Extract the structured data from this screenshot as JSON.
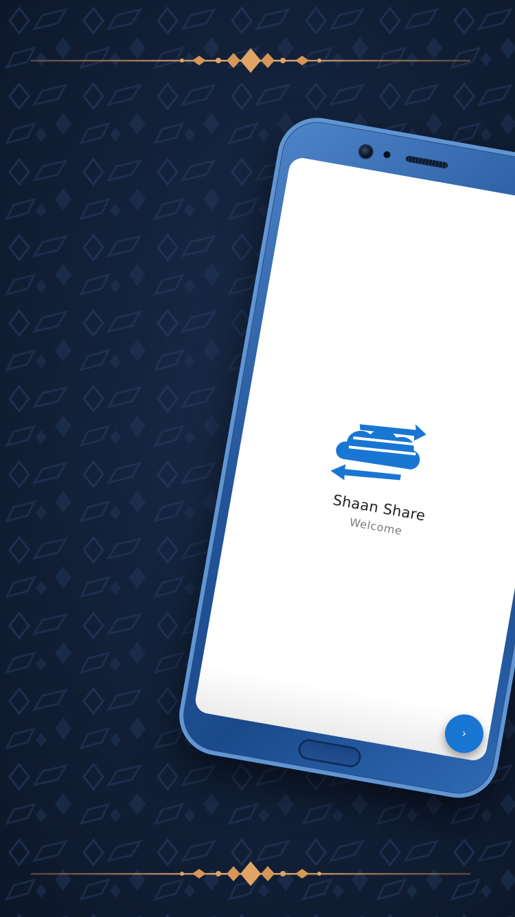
{
  "app": {
    "title": "Shaan Share",
    "subtitle": "Welcome"
  },
  "next_button": {
    "label": "›"
  },
  "colors": {
    "background": "#13223b",
    "ornament_gold": "#d9a064",
    "phone_body": "#23559a",
    "accent_blue": "#1976d2",
    "screen": "#ffffff"
  },
  "icons": {
    "logo": "cloud-transfer-icon",
    "next": "chevron-right-icon"
  }
}
